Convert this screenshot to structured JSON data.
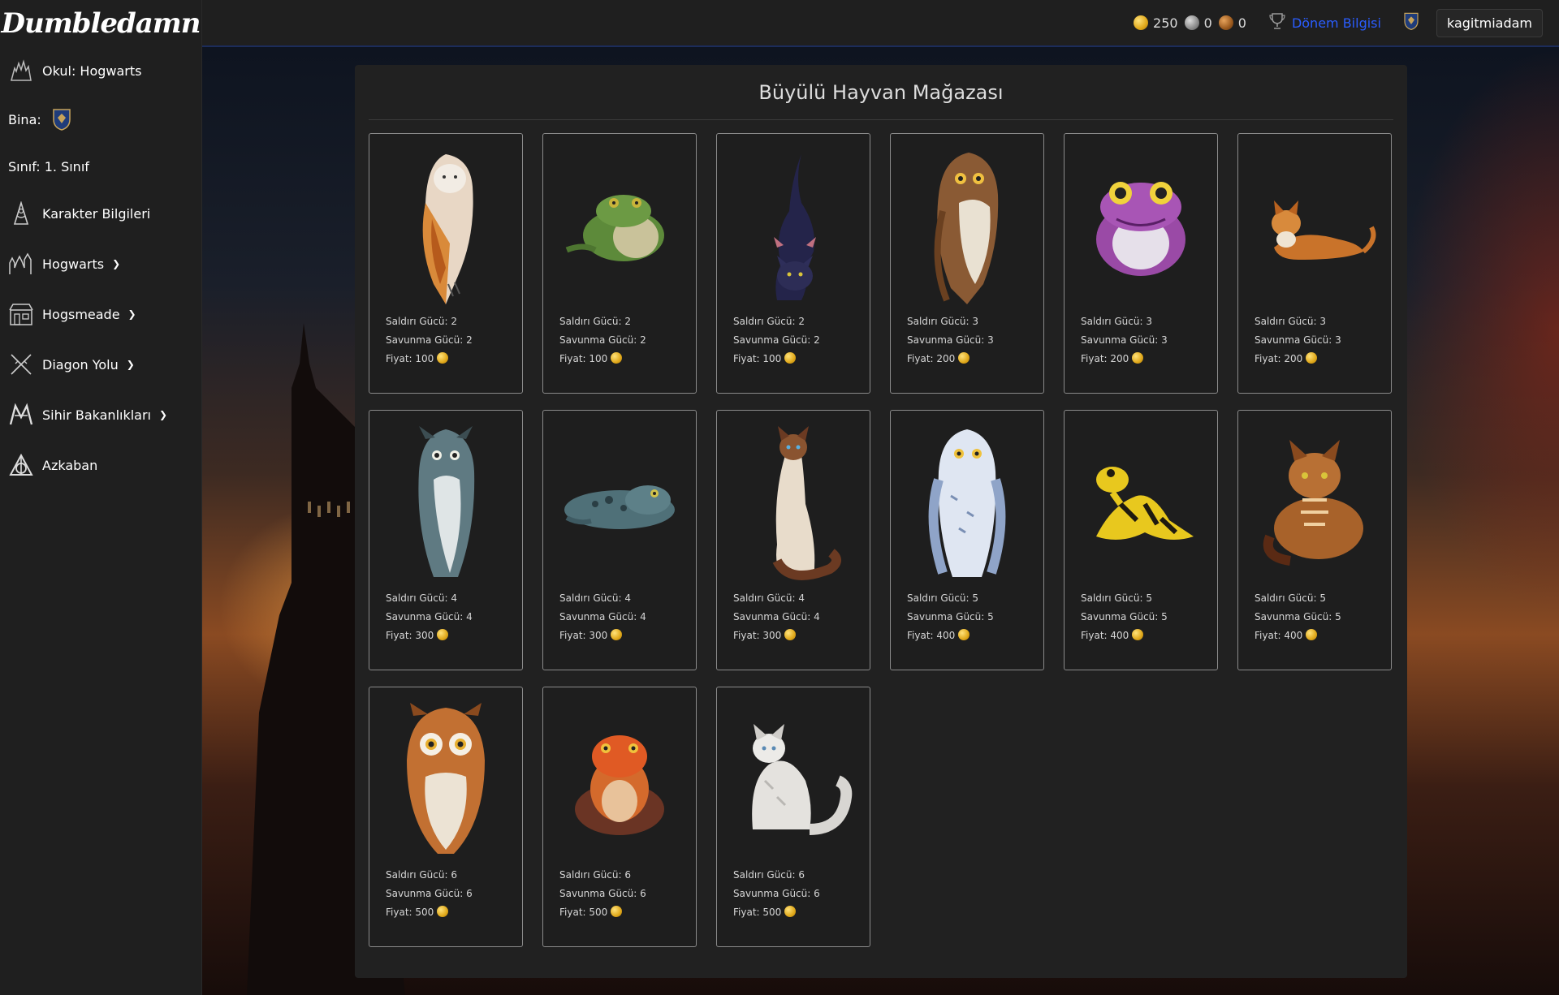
{
  "brand": "Dumbledamn",
  "sidebar": {
    "school": "Okul: Hogwarts",
    "house_label": "Bina:",
    "grade": "Sınıf: 1. Sınıf",
    "items": [
      {
        "label": "Karakter Bilgileri",
        "icon": "wizard-hat-icon"
      },
      {
        "label": "Hogwarts",
        "icon": "castle-icon"
      },
      {
        "label": "Hogsmeade",
        "icon": "shop-icon"
      },
      {
        "label": "Diagon Yolu",
        "icon": "crossed-wands-icon"
      },
      {
        "label": "Sihir Bakanlıkları",
        "icon": "ministry-icon"
      },
      {
        "label": "Azkaban",
        "icon": "deathly-hallows-icon"
      }
    ]
  },
  "topbar": {
    "gold": "250",
    "silver": "0",
    "bronze": "0",
    "term_link": "Dönem Bilgisi",
    "username": "kagitmiadam"
  },
  "shop": {
    "title": "Büyülü Hayvan Mağazası",
    "labels": {
      "attack": "Saldırı Gücü: ",
      "defense": "Savunma Gücü: ",
      "price": "Fiyat: "
    },
    "items": [
      {
        "animal": "barn-owl",
        "attack": "2",
        "defense": "2",
        "price": "100"
      },
      {
        "animal": "green-toad",
        "attack": "2",
        "defense": "2",
        "price": "100"
      },
      {
        "animal": "black-cat",
        "attack": "2",
        "defense": "2",
        "price": "100"
      },
      {
        "animal": "brown-owl",
        "attack": "3",
        "defense": "3",
        "price": "200"
      },
      {
        "animal": "purple-toad",
        "attack": "3",
        "defense": "3",
        "price": "200"
      },
      {
        "animal": "orange-cat",
        "attack": "3",
        "defense": "3",
        "price": "200"
      },
      {
        "animal": "grey-owl",
        "attack": "4",
        "defense": "4",
        "price": "300"
      },
      {
        "animal": "blue-toad",
        "attack": "4",
        "defense": "4",
        "price": "300"
      },
      {
        "animal": "siamese-cat",
        "attack": "4",
        "defense": "4",
        "price": "300"
      },
      {
        "animal": "snowy-owl",
        "attack": "5",
        "defense": "5",
        "price": "400"
      },
      {
        "animal": "yellow-frog",
        "attack": "5",
        "defense": "5",
        "price": "400"
      },
      {
        "animal": "tabby-cat",
        "attack": "5",
        "defense": "5",
        "price": "400"
      },
      {
        "animal": "orange-owl",
        "attack": "6",
        "defense": "6",
        "price": "500"
      },
      {
        "animal": "red-toad",
        "attack": "6",
        "defense": "6",
        "price": "500"
      },
      {
        "animal": "white-cat",
        "attack": "6",
        "defense": "6",
        "price": "500"
      }
    ]
  }
}
